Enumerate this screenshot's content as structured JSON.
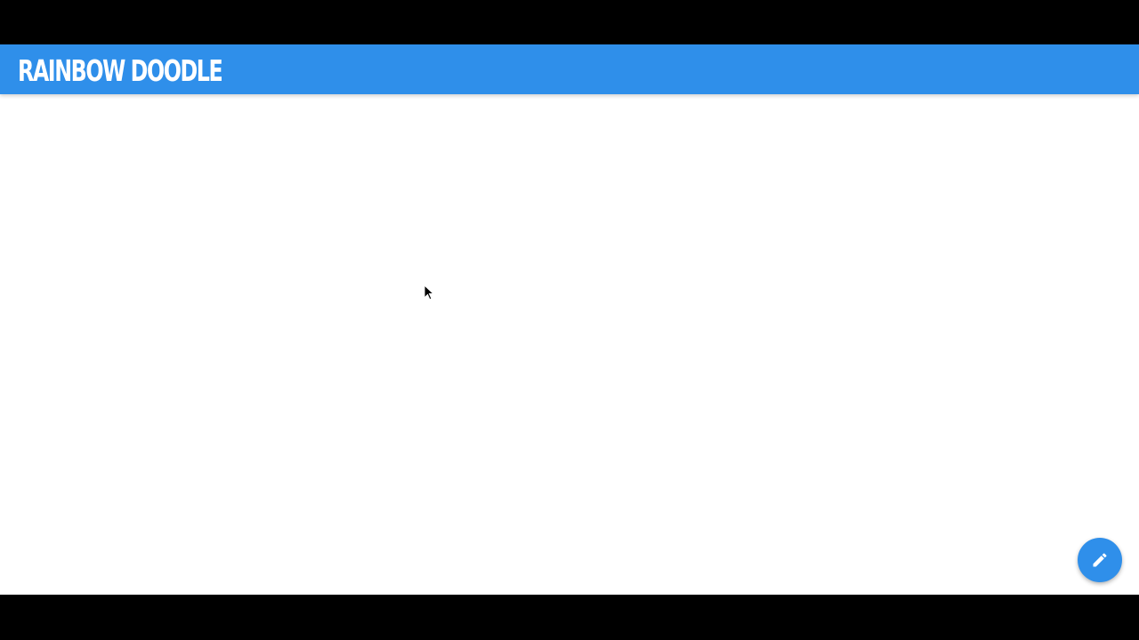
{
  "app": {
    "title": "RAINBOW DOODLE"
  },
  "colors": {
    "accent": "#2f8fea",
    "canvas": "#ffffff",
    "letterbox": "#000000"
  },
  "fab": {
    "icon": "pencil-icon"
  }
}
